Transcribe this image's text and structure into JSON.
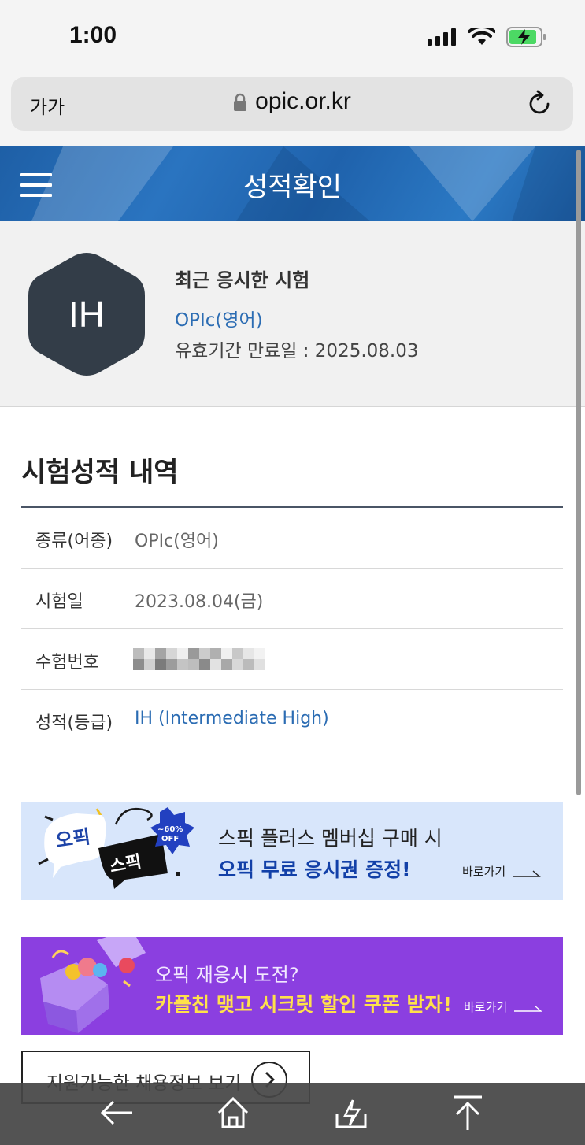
{
  "status_bar": {
    "time": "1:00",
    "battery_color": "#4cd964"
  },
  "browser": {
    "text_size_label": "가가",
    "url": "opic.or.kr"
  },
  "header": {
    "title": "성적확인",
    "color": "#1f64ad"
  },
  "summary": {
    "grade_badge": "IH",
    "badge_color": "#333d48",
    "title": "최근 응시한 시험",
    "exam": "OPIc(영어)",
    "expiry": "유효기간 만료일 : 2025.08.03"
  },
  "results": {
    "section_title": "시험성적 내역",
    "rows": [
      {
        "label": "종류(어종)",
        "value": "OPIc(영어)"
      },
      {
        "label": "시험일",
        "value": "2023.08.04(금)"
      },
      {
        "label": "수험번호",
        "value": ""
      },
      {
        "label": "성적(등급)",
        "value": "IH (Intermediate High)"
      }
    ]
  },
  "banner_spic": {
    "logo_text": "오픽",
    "badge_text": "스픽",
    "discount": "~60%",
    "discount_sub": "OFF",
    "line1": "스픽 플러스 멤버십 구매 시",
    "line2": "오픽 무료 응시권 증정!",
    "more": "바로가기"
  },
  "banner_coupon": {
    "line1": "오픽 재응시 도전?",
    "line2": "카플친 맺고 시크릿 할인 쿠폰 받자!",
    "more": "바로가기"
  },
  "job_button": {
    "label": "지원가능한 채용정보 보기"
  },
  "toolbar": {
    "items": [
      "back",
      "home",
      "share",
      "scroll-top"
    ]
  }
}
